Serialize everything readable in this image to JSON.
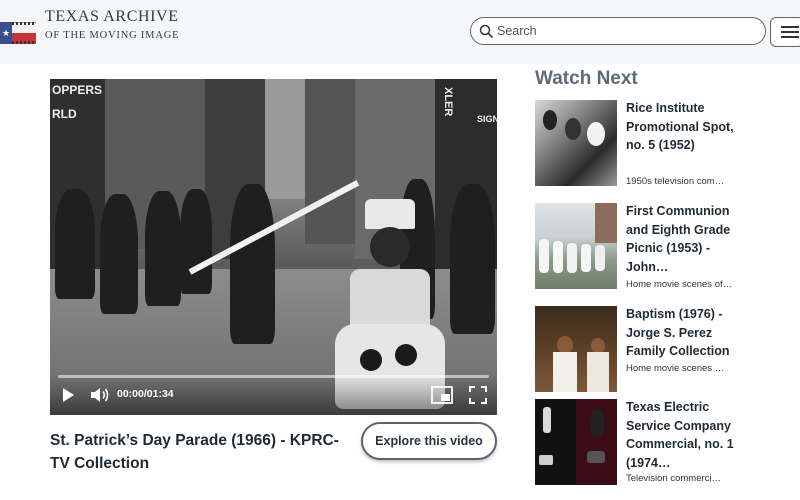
{
  "header": {
    "logo_title": "TEXAS ARCHIVE",
    "logo_subtitle": "OF THE MOVING IMAGE",
    "search_placeholder": "Search"
  },
  "video": {
    "title": "St. Patrick’s Day Parade (1966) - KPRC-TV Collection",
    "time_display": "00:00/01:34",
    "progress": 0,
    "explore_label": "Explore this video",
    "signage": [
      "OPPERS",
      "RLD",
      "XLER",
      "SIGN"
    ]
  },
  "watch_next": {
    "heading": "Watch Next",
    "items": [
      {
        "title": "Rice Institute Promotional Spot, no. 5 (1952)",
        "description": "1950s television com…"
      },
      {
        "title": "First Communion and Eighth Grade Picnic (1953) - John…",
        "description": "Home movie scenes of…"
      },
      {
        "title": "Baptism (1976) - Jorge S. Perez Family Collection",
        "description": "Home movie scenes …"
      },
      {
        "title": "Texas Electric Service Company Commercial, no. 1 (1974…",
        "description": "Television commerci…"
      }
    ]
  },
  "colors": {
    "heading_gray": "#5d6b78",
    "text_dark": "#1e2a35",
    "header_bg": "#f4f6f8",
    "border": "#5b6570"
  },
  "icons": [
    "texas-flag-film-logo-icon",
    "search-icon",
    "menu-icon",
    "play-icon",
    "volume-icon",
    "picture-in-picture-icon",
    "fullscreen-icon"
  ]
}
